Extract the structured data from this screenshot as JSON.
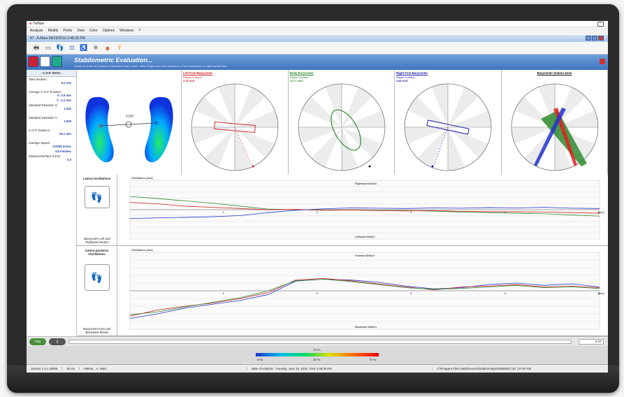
{
  "app": {
    "title": "TwiNav",
    "window_caption": "N° : A.Mars 06/19/2016 2:48:35 PM"
  },
  "menu": [
    "Analysis",
    "Modify",
    "Prints",
    "View",
    "Color",
    "Options",
    "Windows",
    "?"
  ],
  "banner": {
    "title": "Stabilometric Evaluation...",
    "subtitle": "Graph of center of pressure (Calibrated load) Lower: faster (Right foot) left oscillations of the barycenter of right and left feet"
  },
  "left_panel": {
    "header": "- C.O.P. DATA -",
    "rows": [
      {
        "label": "Start duration:",
        "value": "5.0 sec"
      },
      {
        "label": "Average C.O.P. Position:",
        "value": "X: 0.5 mm"
      },
      {
        "label": "",
        "value": "Y: -1.2 mm"
      },
      {
        "label": "Standard Deviation X:",
        "value": "1.202"
      },
      {
        "label": "Standard Deviation Y:",
        "value": "1.939"
      },
      {
        "label": "C.O.P. Distance:",
        "value": "19.1 mm"
      },
      {
        "label": "Average Speed:",
        "value": "0.0039 m/sec"
      },
      {
        "label": "",
        "value": "3.8 mm/sec"
      },
      {
        "label": "Distance/Surface (LFS):",
        "value": "3.0"
      }
    ]
  },
  "foot_panel": {
    "angle": "2.50°"
  },
  "stabilograms": [
    {
      "label": "Left Foot Barycenter",
      "info": "Ellipse Surface",
      "value": "4.25 mm²",
      "color": "#cc2222"
    },
    {
      "label": "Body Barycenter",
      "info": "Ellipse Surface",
      "value": "19.77 mm²",
      "color": "#2e8b2e"
    },
    {
      "label": "Right Foot Barycenter",
      "info": "Ellipse Surface",
      "value": "4.80 mm²",
      "color": "#2222aa"
    },
    {
      "label": "Barycenter Station Zone",
      "info": "",
      "value": "",
      "color": "#111111"
    }
  ],
  "lateral": {
    "title": "Lateral Oscillations",
    "foot": "Barycenter Left and Rightward Motion",
    "ylabel": "Oscillations [mm]",
    "top_label": "Rightward Motion",
    "bottom_label": "Leftward Motion"
  },
  "antero": {
    "title": "Antero-posterior Oscillations",
    "foot": "Barycenter Fore and Backward Motion",
    "ylabel": "Oscillations [mm]",
    "top_label": "Forward Motion",
    "bottom_label": "Backward Motion"
  },
  "chart_axis": {
    "xticks": [
      "1",
      "2",
      "3",
      "4",
      "5"
    ],
    "xunit": "[sec]"
  },
  "playback": {
    "play": "Play",
    "pause": "||",
    "time": "5.07"
  },
  "colorbar": {
    "max": "75 Pa",
    "min": "0 Pa",
    "mid": "38 Pa",
    "end": "75 Pa"
  },
  "status": {
    "version": "Version 1.0.1.19055",
    "ms": "35 ms",
    "patient": "Patient... A. Mars",
    "date": "Date of Analysis : Tuesday, June 19, 2016, Time 2:48:35 PM",
    "path": "C:\\Program Files (x86)\\Sensor\\Studio\\Analyst\\00000027.sfc | 57.97 KB"
  }
}
